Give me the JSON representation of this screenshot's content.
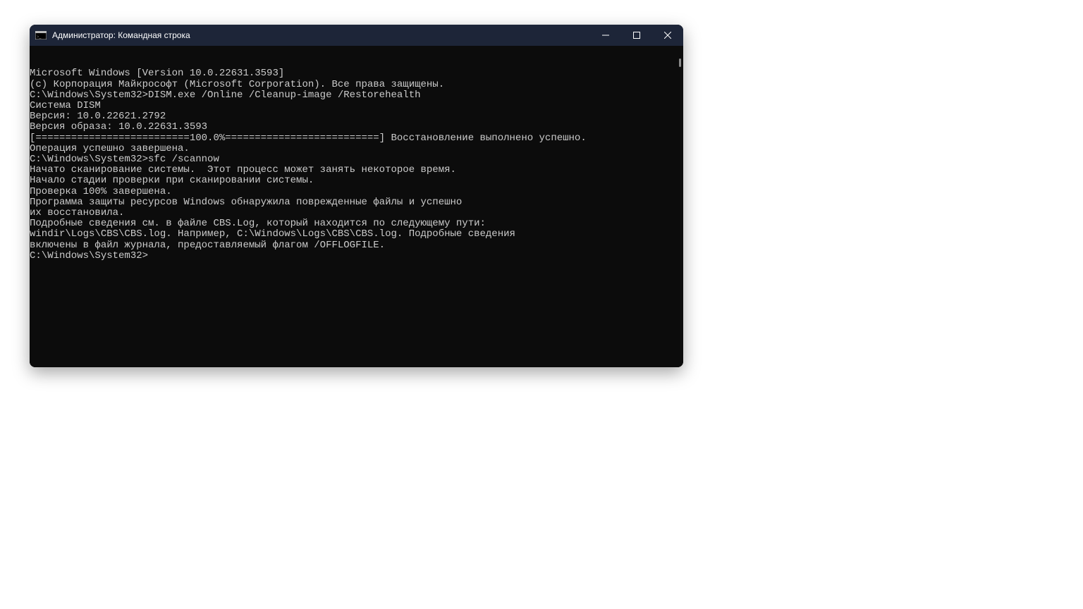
{
  "window": {
    "title": "Администратор: Командная строка"
  },
  "terminal": {
    "lines": [
      "Microsoft Windows [Version 10.0.22631.3593]",
      "(c) Корпорация Майкрософт (Microsoft Corporation). Все права защищены.",
      "",
      "C:\\Windows\\System32>DISM.exe /Online /Cleanup-image /Restorehealth",
      "",
      "Cистема DISM",
      "Версия: 10.0.22621.2792",
      "",
      "Версия образа: 10.0.22631.3593",
      "",
      "[==========================100.0%==========================] Восстановление выполнено успешно.",
      "Операция успешно завершена.",
      "",
      "C:\\Windows\\System32>sfc /scannow",
      "",
      "Начато сканирование системы.  Этот процесс может занять некоторое время.",
      "",
      "Начало стадии проверки при сканировании системы.",
      "Проверка 100% завершена.",
      "",
      "Программа защиты ресурсов Windows обнаружила поврежденные файлы и успешно",
      "их восстановила.",
      "Подробные сведения см. в файле CBS.Log, который находится по следующему пути:",
      "windir\\Logs\\CBS\\CBS.log. Например, C:\\Windows\\Logs\\CBS\\CBS.log. Подробные сведения",
      "включены в файл журнала, предоставляемый флагом /OFFLOGFILE.",
      "",
      "C:\\Windows\\System32>"
    ]
  }
}
